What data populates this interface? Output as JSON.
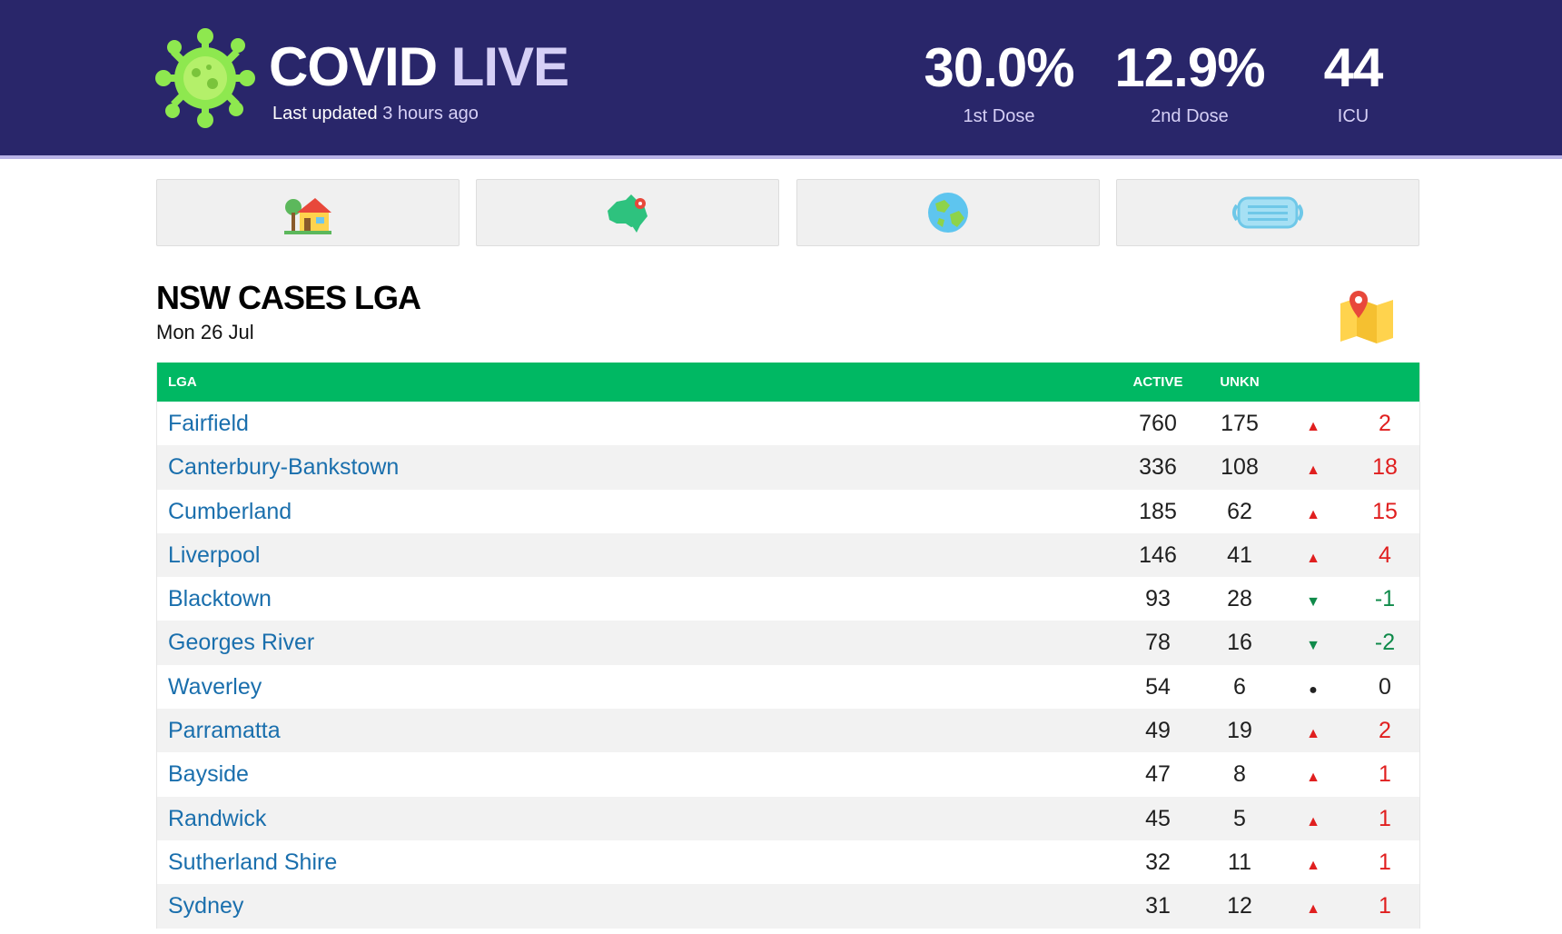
{
  "header": {
    "title_main": "COVID",
    "title_accent": "LIVE",
    "updated_label": "Last updated",
    "updated_ago": "3 hours ago",
    "stats": [
      {
        "value": "30.0%",
        "label": "1st Dose"
      },
      {
        "value": "12.9%",
        "label": "2nd Dose"
      },
      {
        "value": "44",
        "label": "ICU"
      }
    ]
  },
  "nav": [
    {
      "icon": "house-icon"
    },
    {
      "icon": "australia-map-icon"
    },
    {
      "icon": "globe-icon"
    },
    {
      "icon": "face-mask-icon"
    }
  ],
  "section": {
    "title": "NSW CASES LGA",
    "date": "Mon 26 Jul",
    "map_icon": "map-pin-icon"
  },
  "table": {
    "headers": {
      "lga": "LGA",
      "active": "ACTIVE",
      "unkn": "UNKN"
    },
    "rows": [
      {
        "name": "Fairfield",
        "active": "760",
        "unkn": "175",
        "trend": "up",
        "arrow": "▲",
        "change": "2"
      },
      {
        "name": "Canterbury-Bankstown",
        "active": "336",
        "unkn": "108",
        "trend": "up",
        "arrow": "▲",
        "change": "18"
      },
      {
        "name": "Cumberland",
        "active": "185",
        "unkn": "62",
        "trend": "up",
        "arrow": "▲",
        "change": "15"
      },
      {
        "name": "Liverpool",
        "active": "146",
        "unkn": "41",
        "trend": "up",
        "arrow": "▲",
        "change": "4"
      },
      {
        "name": "Blacktown",
        "active": "93",
        "unkn": "28",
        "trend": "down",
        "arrow": "▼",
        "change": "-1"
      },
      {
        "name": "Georges River",
        "active": "78",
        "unkn": "16",
        "trend": "down",
        "arrow": "▼",
        "change": "-2"
      },
      {
        "name": "Waverley",
        "active": "54",
        "unkn": "6",
        "trend": "flat",
        "arrow": "●",
        "change": "0"
      },
      {
        "name": "Parramatta",
        "active": "49",
        "unkn": "19",
        "trend": "up",
        "arrow": "▲",
        "change": "2"
      },
      {
        "name": "Bayside",
        "active": "47",
        "unkn": "8",
        "trend": "up",
        "arrow": "▲",
        "change": "1"
      },
      {
        "name": "Randwick",
        "active": "45",
        "unkn": "5",
        "trend": "up",
        "arrow": "▲",
        "change": "1"
      },
      {
        "name": "Sutherland Shire",
        "active": "32",
        "unkn": "11",
        "trend": "up",
        "arrow": "▲",
        "change": "1"
      },
      {
        "name": "Sydney",
        "active": "31",
        "unkn": "12",
        "trend": "up",
        "arrow": "▲",
        "change": "1"
      }
    ]
  },
  "colors": {
    "header_bg": "#29266a",
    "table_header_bg": "#00b863",
    "link": "#1a6fad",
    "up": "#e01f1f",
    "down": "#0f8a4a"
  }
}
